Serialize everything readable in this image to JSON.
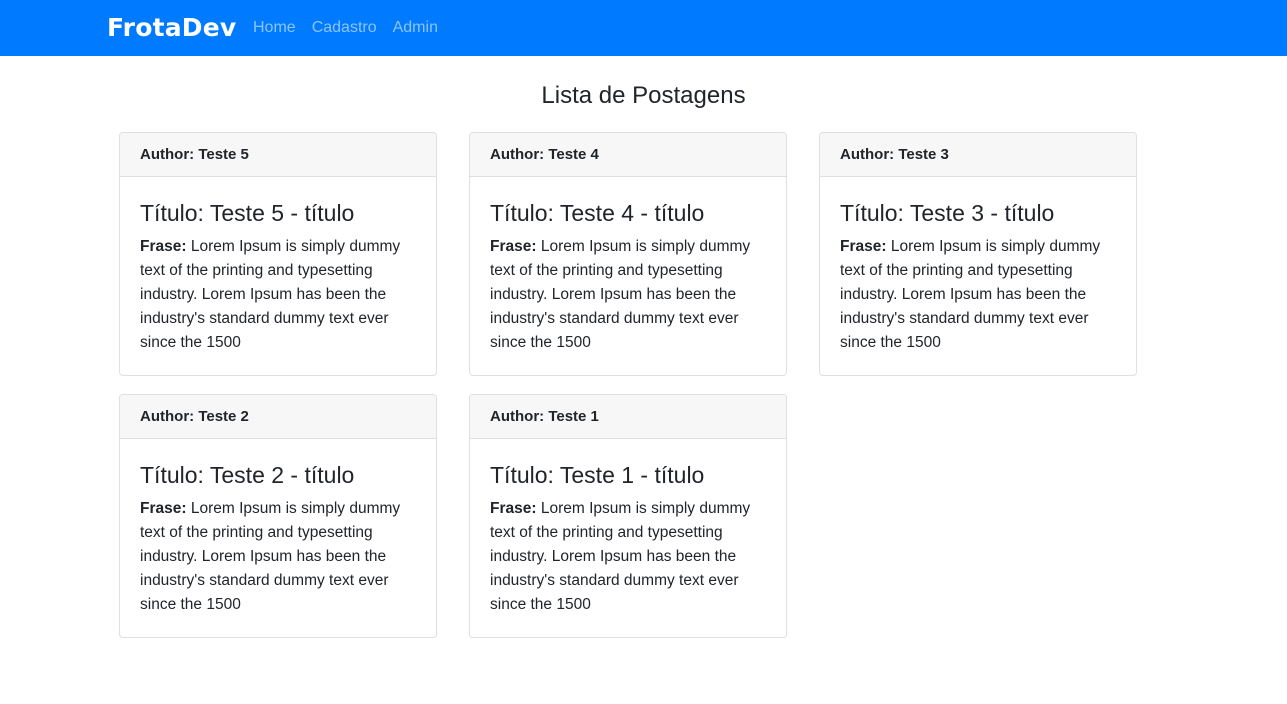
{
  "navbar": {
    "brand": "FrotaDev",
    "links": [
      "Home",
      "Cadastro",
      "Admin"
    ]
  },
  "page_title": "Lista de Postagens",
  "posts": [
    {
      "author": "Author: Teste 5",
      "title": "Título: Teste 5 - título",
      "phrase_label": "Frase:",
      "phrase": "Lorem Ipsum is simply dummy text of the printing and typesetting industry. Lorem Ipsum has been the industry's standard dummy text ever since the 1500"
    },
    {
      "author": "Author: Teste 4",
      "title": "Título: Teste 4 - título",
      "phrase_label": "Frase:",
      "phrase": "Lorem Ipsum is simply dummy text of the printing and typesetting industry. Lorem Ipsum has been the industry's standard dummy text ever since the 1500"
    },
    {
      "author": "Author: Teste 3",
      "title": "Título: Teste 3 - título",
      "phrase_label": "Frase:",
      "phrase": "Lorem Ipsum is simply dummy text of the printing and typesetting industry. Lorem Ipsum has been the industry's standard dummy text ever since the 1500"
    },
    {
      "author": "Author: Teste 2",
      "title": "Título: Teste 2 - título",
      "phrase_label": "Frase:",
      "phrase": "Lorem Ipsum is simply dummy text of the printing and typesetting industry. Lorem Ipsum has been the industry's standard dummy text ever since the 1500"
    },
    {
      "author": "Author: Teste 1",
      "title": "Título: Teste 1 - título",
      "phrase_label": "Frase:",
      "phrase": "Lorem Ipsum is simply dummy text of the printing and typesetting industry. Lorem Ipsum has been the industry's standard dummy text ever since the 1500"
    }
  ],
  "colors": {
    "navbar_bg": "#007bff",
    "card_header_bg": "#f7f7f7",
    "card_border": "#dfdfdf"
  }
}
